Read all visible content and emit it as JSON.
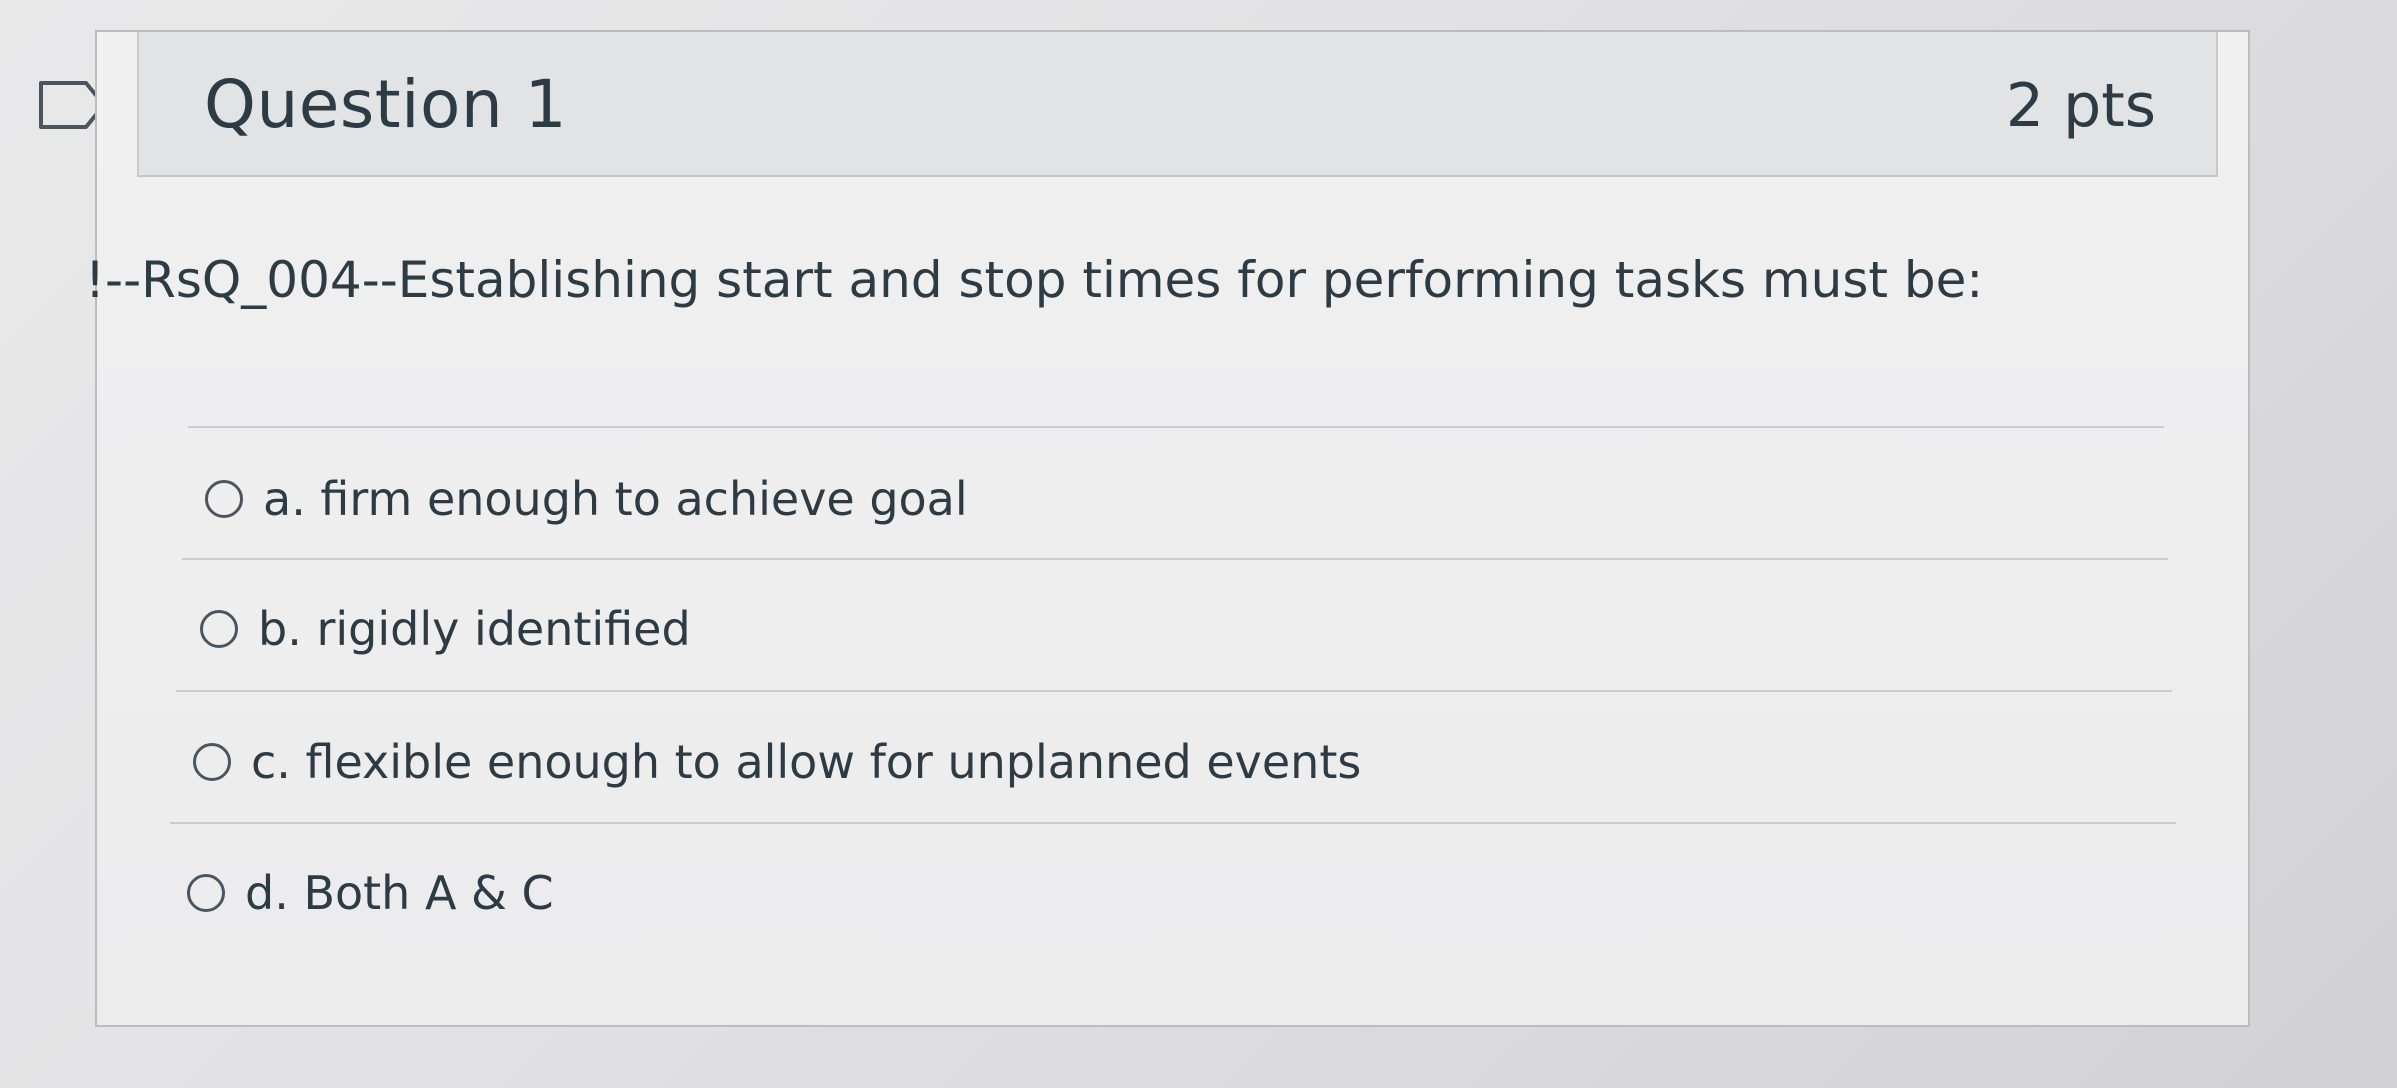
{
  "question": {
    "title": "Question 1",
    "points": "2 pts",
    "text": "!--RsQ_004--Establishing start and stop times for performing tasks must be:"
  },
  "answers": [
    {
      "label": "a. firm enough to achieve goal",
      "selected": false
    },
    {
      "label": "b. rigidly identified",
      "selected": false
    },
    {
      "label": "c. flexible enough to allow for unplanned events",
      "selected": false
    },
    {
      "label": "d. Both A & C",
      "selected": false
    }
  ],
  "icons": {
    "flag": "bookmark-flag-icon",
    "radio": "radio-button-unchecked-icon"
  }
}
